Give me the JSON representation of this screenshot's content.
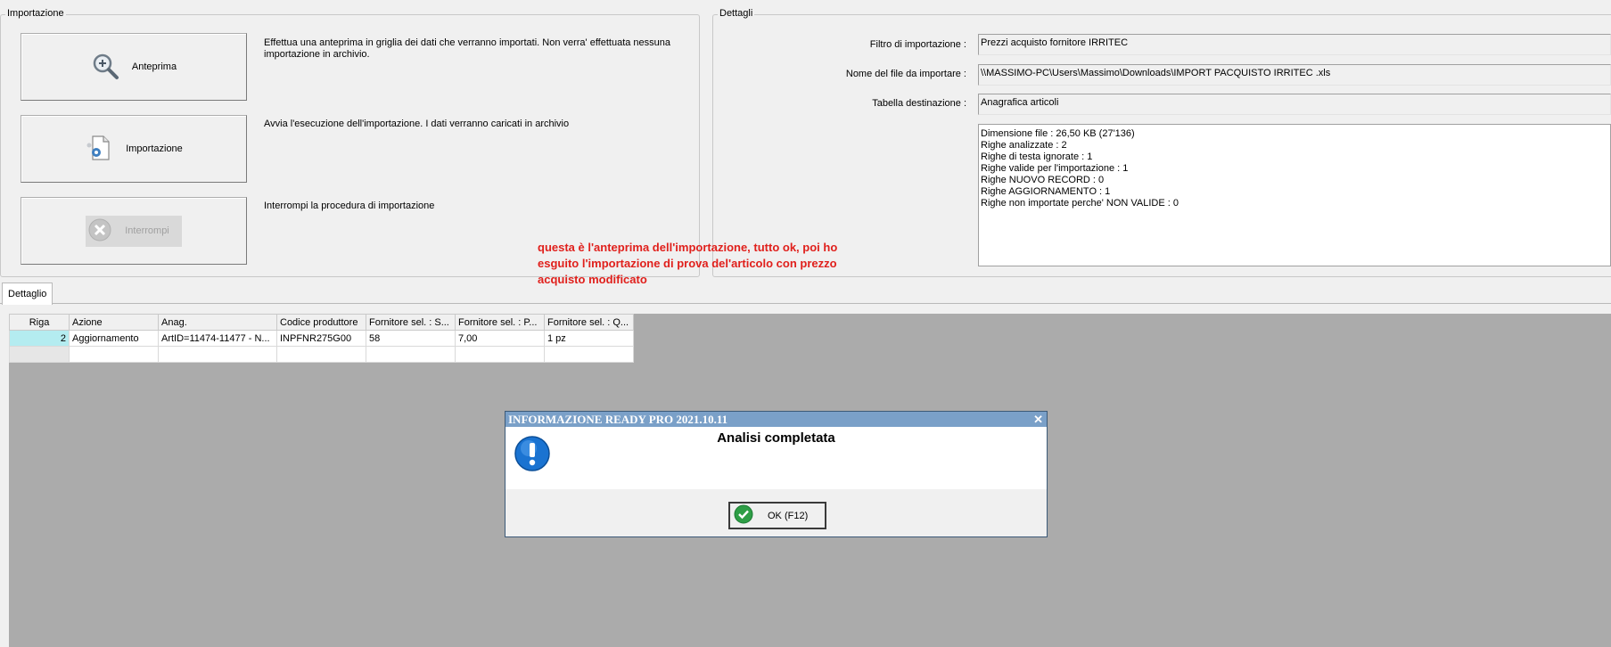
{
  "importazione": {
    "legend": "Importazione",
    "buttons": [
      {
        "label": "Anteprima",
        "icon": "magnifier-plus-icon",
        "desc": "Effettua una anteprima in griglia dei dati che verranno importati. Non verra' effettuata nessuna importazione in archivio."
      },
      {
        "label": "Importazione",
        "icon": "document-gear-icon",
        "desc": "Avvia l'esecuzione dell'importazione. I dati verranno caricati in archivio"
      },
      {
        "label": "Interrompi",
        "icon": "cancel-circle-icon",
        "desc": "Interrompi la procedura di importazione",
        "disabled": true
      }
    ]
  },
  "dettagli": {
    "legend": "Dettagli",
    "filtro_label": "Filtro di importazione :",
    "filtro_value": "Prezzi acquisto fornitore IRRITEC",
    "file_label": "Nome del file da importare :",
    "file_value": "\\\\MASSIMO-PC\\Users\\Massimo\\Downloads\\IMPORT PACQUISTO IRRITEC .xls",
    "tabella_label": "Tabella destinazione :",
    "tabella_value": "Anagrafica articoli",
    "log_lines": [
      "Dimensione file : 26,50 KB (27'136)",
      "Righe analizzate : 2",
      "Righe di testa ignorate : 1",
      "Righe valide per l'importazione : 1",
      "Righe NUOVO RECORD : 0",
      "Righe AGGIORNAMENTO  : 1",
      "Righe non importate perche' NON VALIDE : 0"
    ]
  },
  "note": {
    "lines": [
      "questa è l'anteprima dell'importazione, tutto ok, poi ho",
      "esguito l'importazione di prova del'articolo con prezzo",
      "acquisto modificato"
    ],
    "color": "#e0201c"
  },
  "tabs": [
    {
      "label": "Dettaglio"
    }
  ],
  "grid": {
    "columns": [
      "Riga",
      "Azione",
      "Anag.",
      "Codice produttore",
      "Fornitore sel. : S...",
      "Fornitore sel. : P...",
      "Fornitore sel. : Q..."
    ],
    "rows": [
      [
        "2",
        "Aggiornamento",
        "ArtID=11474-11477 - N...",
        "INPFNR275G00",
        "58",
        "7,00",
        "1 pz"
      ]
    ]
  },
  "dialog": {
    "title": "INFORMAZIONE READY PRO 2021.10.11",
    "close": "✕",
    "message": "Analisi completata",
    "ok_label": "OK (F12)"
  }
}
